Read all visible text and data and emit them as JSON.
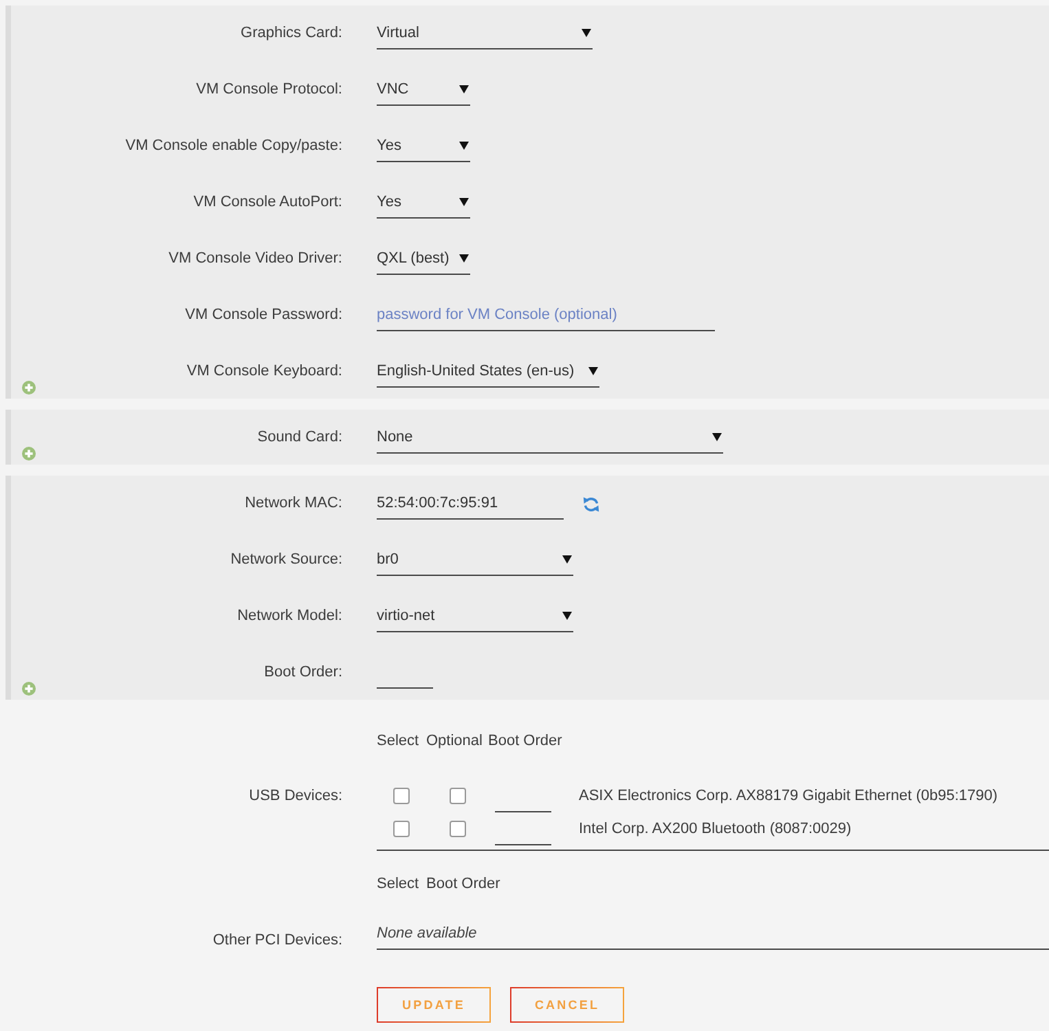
{
  "panels": [
    {
      "fields": [
        {
          "label": "Graphics Card:",
          "kind": "select",
          "value": "Virtual"
        },
        {
          "label": "VM Console Protocol:",
          "kind": "select",
          "value": "VNC"
        },
        {
          "label": "VM Console enable Copy/paste:",
          "kind": "select",
          "value": "Yes"
        },
        {
          "label": "VM Console AutoPort:",
          "kind": "select",
          "value": "Yes"
        },
        {
          "label": "VM Console Video Driver:",
          "kind": "select",
          "value": "QXL (best)"
        },
        {
          "label": "VM Console Password:",
          "kind": "text",
          "placeholder": "password for VM Console (optional)"
        },
        {
          "label": "VM Console Keyboard:",
          "kind": "select",
          "value": "English-United States (en-us)"
        }
      ]
    },
    {
      "fields": [
        {
          "label": "Sound Card:",
          "kind": "select",
          "value": "None"
        }
      ]
    },
    {
      "fields": [
        {
          "label": "Network MAC:",
          "kind": "text_refresh",
          "value": "52:54:00:7c:95:91"
        },
        {
          "label": "Network Source:",
          "kind": "select",
          "value": "br0"
        },
        {
          "label": "Network Model:",
          "kind": "select",
          "value": "virtio-net"
        },
        {
          "label": "Boot Order:",
          "kind": "text"
        }
      ]
    }
  ],
  "usb_devices": {
    "label": "USB Devices:",
    "columns": [
      "Select",
      "Optional",
      "Boot Order"
    ],
    "devices": [
      {
        "name": "ASIX Electronics Corp. AX88179 Gigabit Ethernet (0b95:1790)",
        "select_checked": false,
        "optional_checked": false
      },
      {
        "name": "Intel Corp. AX200 Bluetooth (8087:0029)",
        "select_checked": false,
        "optional_checked": false
      }
    ]
  },
  "other_pci_devices": {
    "label": "Other PCI Devices:",
    "columns": [
      "Select",
      "Boot Order"
    ],
    "empty_text": "None available"
  },
  "buttons": [
    "UPDATE",
    "CANCEL"
  ]
}
